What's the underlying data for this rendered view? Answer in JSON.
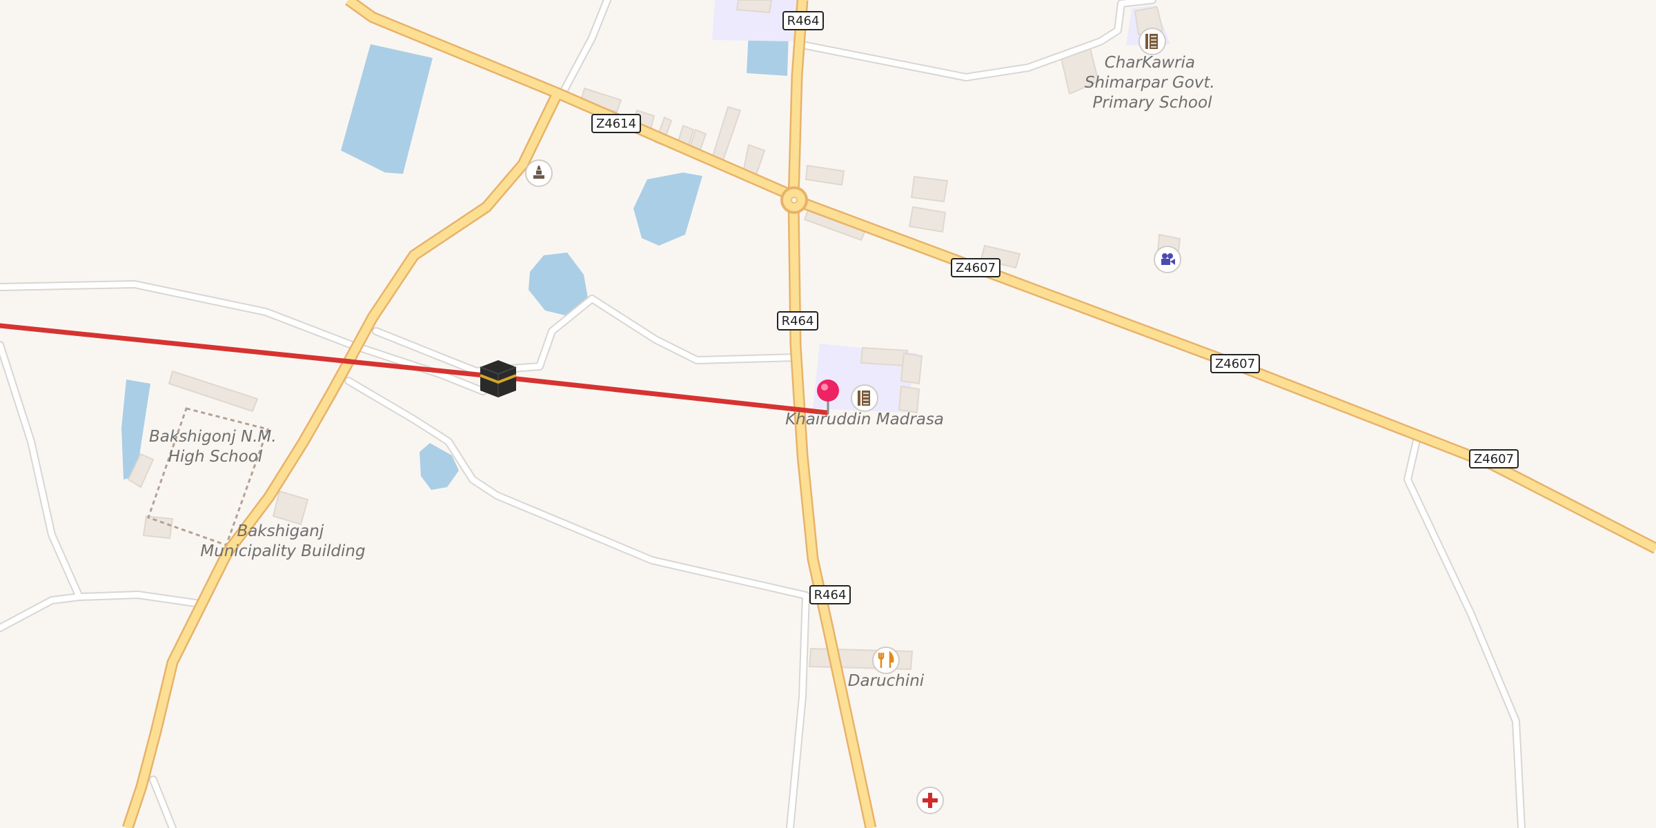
{
  "map": {
    "road_shields": [
      {
        "id": "r464-top",
        "text": "R464"
      },
      {
        "id": "r464-mid",
        "text": "R464"
      },
      {
        "id": "r464-low",
        "text": "R464"
      },
      {
        "id": "z4614",
        "text": "Z4614"
      },
      {
        "id": "z4607-a",
        "text": "Z4607"
      },
      {
        "id": "z4607-b",
        "text": "Z4607"
      },
      {
        "id": "z4607-c",
        "text": "Z4607"
      }
    ],
    "places": {
      "charkawria": [
        "CharKawria",
        "Shimarpar Govt.",
        "Primary School"
      ],
      "bakshigonj_school": [
        "Bakshigonj N.M.",
        "High School"
      ],
      "bakshiganj_municipality": [
        "Bakshiganj",
        "Municipality Building"
      ],
      "khairuddin": "Khairuddin Madrasa",
      "daruchini": "Daruchini"
    },
    "pois": [
      {
        "name": "school-icon",
        "place": "charkawria"
      },
      {
        "name": "school-icon",
        "place": "khairuddin"
      },
      {
        "name": "cinema-icon"
      },
      {
        "name": "monument-icon"
      },
      {
        "name": "restaurant-icon",
        "place": "daruchini"
      },
      {
        "name": "hospital-icon"
      },
      {
        "name": "kaaba-icon"
      },
      {
        "name": "location-pin-icon"
      }
    ],
    "colors": {
      "background": "#f9f6f2",
      "major_road": "#fcdf92",
      "major_road_casing": "#e8b26a",
      "minor_road": "#ffffff",
      "minor_road_casing": "#d8d6d2",
      "water": "#aacee6",
      "building": "#ece6df",
      "institution": "#eceafc",
      "route": "#d63330",
      "pin": "#ee2364"
    }
  }
}
